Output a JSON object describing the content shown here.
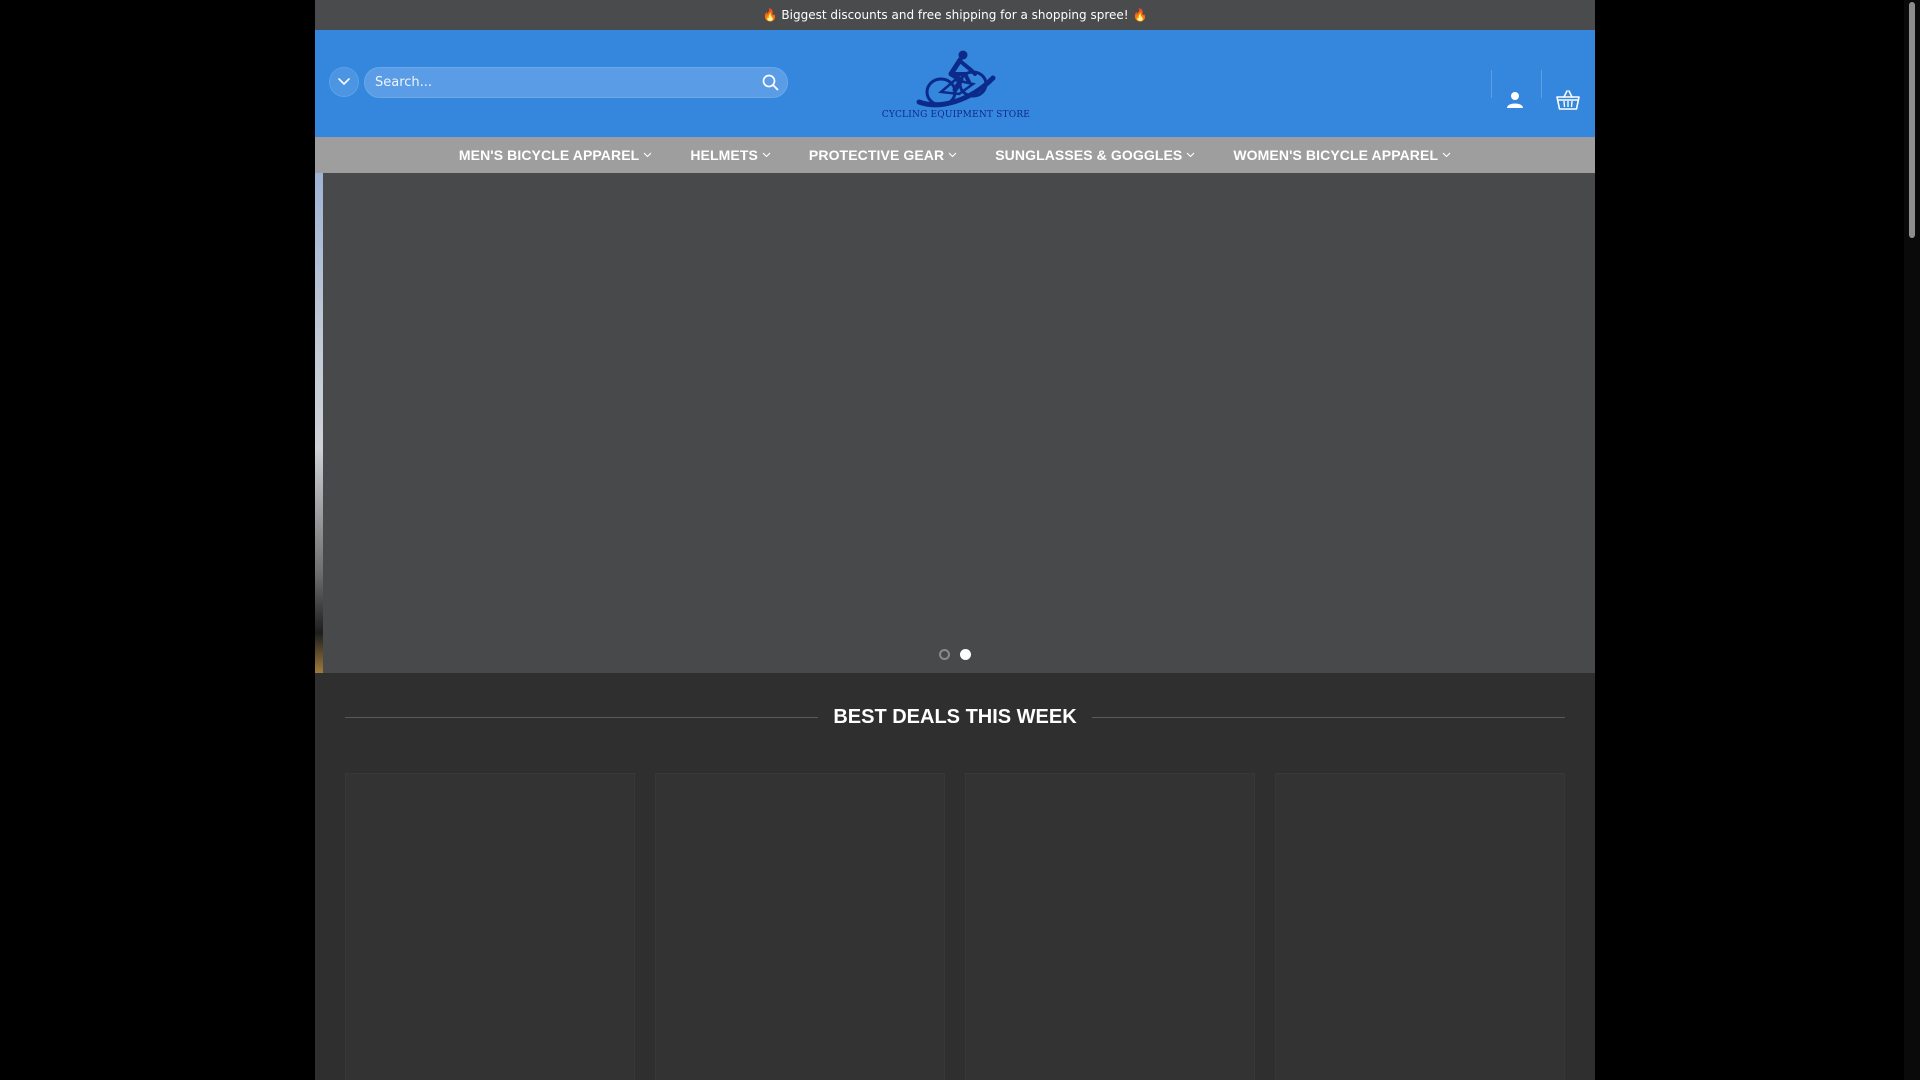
{
  "topbar": {
    "promo_text": "Biggest discounts and free shipping for a shopping spree!",
    "fire_icon": "🔥"
  },
  "header": {
    "search": {
      "placeholder": "Search..."
    },
    "logo": {
      "text": "CYCLING EQUIPMENT STORE"
    },
    "colors": {
      "header_bg": "#3587dd",
      "logo_blue": "#0b2a8a"
    }
  },
  "nav": {
    "items": [
      {
        "label": "MEN'S BICYCLE APPAREL"
      },
      {
        "label": "HELMETS"
      },
      {
        "label": "PROTECTIVE GEAR"
      },
      {
        "label": "SUNGLASSES & GOGGLES"
      },
      {
        "label": "WOMEN'S BICYCLE APPAREL"
      }
    ]
  },
  "slider": {
    "active_dot": 2,
    "dot_count": 2
  },
  "deals": {
    "title": "BEST DEALS THIS WEEK"
  }
}
